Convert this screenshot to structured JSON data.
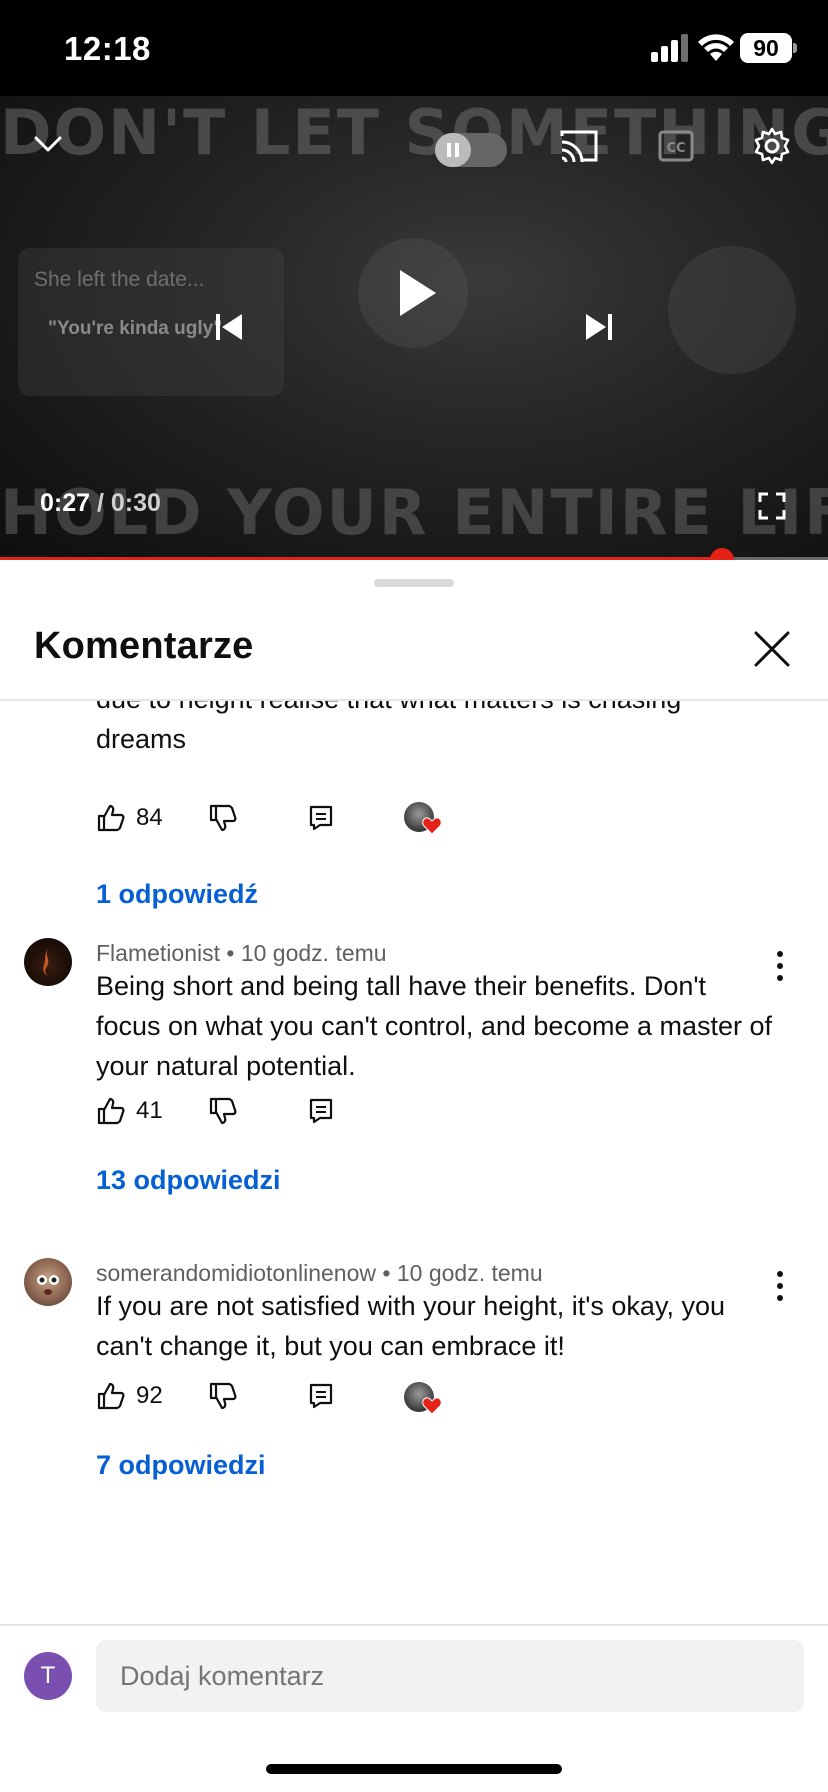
{
  "status_bar": {
    "time": "12:18",
    "battery": "90"
  },
  "video": {
    "overlay_top": "DON'T LET SOMETHING BAD",
    "overlay_bottom": "HOLD YOUR ENTIRE LIFE BACK",
    "thumb_line1": "She left the date...",
    "thumb_line2": "\"You're kinda ugly\"",
    "time_current": "0:27",
    "time_separator": " / ",
    "time_total": "0:30",
    "progress_fraction": 0.872
  },
  "sheet": {
    "title": "Komentarze"
  },
  "comments": [
    {
      "text_partial": "due to height realise that what matters is chasing dreams",
      "likes": "84",
      "creator_hearted": true,
      "replies": "1 odpowiedź"
    },
    {
      "author": "Flametionist",
      "time": "10 godz. temu",
      "text": "Being short and being tall have their benefits. Don't focus on what you can't control, and become a master of your natural potential.",
      "likes": "41",
      "creator_hearted": false,
      "replies": "13 odpowiedzi"
    },
    {
      "author": "somerandomidiotonlinenow",
      "time": "10 godz. temu",
      "text": "If you are not satisfied with your height, it's okay, you can't change it, but you can embrace it!",
      "likes": "92",
      "creator_hearted": true,
      "replies": "7 odpowiedzi"
    }
  ],
  "meta_separator": " • ",
  "composer": {
    "avatar_letter": "T",
    "placeholder": "Dodaj komentarz"
  },
  "colors": {
    "accent_blue": "#065fd4",
    "progress_red": "#e62117",
    "avatar_purple": "#7b4fb0"
  },
  "icons": [
    "chevron-down-icon",
    "pause-icon",
    "cast-icon",
    "captions-icon",
    "settings-icon",
    "previous-icon",
    "play-icon",
    "next-icon",
    "fullscreen-icon",
    "close-icon",
    "like-icon",
    "dislike-icon",
    "reply-icon",
    "heart-icon",
    "more-vertical-icon"
  ]
}
